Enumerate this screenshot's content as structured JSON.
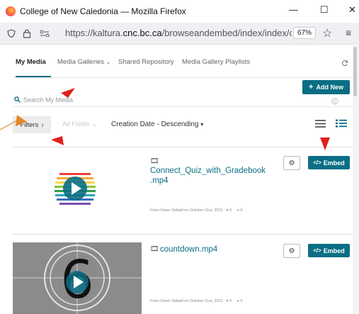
{
  "window": {
    "title": "College of New Caledonia — Mozilla Firefox",
    "minimize": "—",
    "maximize": "☐",
    "close": "✕"
  },
  "browser": {
    "url_prefix": "https://kaltura.",
    "url_domain": "cnc.bc.ca",
    "url_path": "/browseandembed/index/index/catnai",
    "zoom": "67%"
  },
  "nav": {
    "tabs": [
      {
        "label": "My Media",
        "active": true
      },
      {
        "label": "Media Galleries",
        "active": false
      },
      {
        "label": "Shared Repository",
        "active": false
      },
      {
        "label": "Media Gallery Playlists",
        "active": false
      }
    ]
  },
  "toolbar": {
    "add_new_label": "Add New",
    "search_placeholder": "Search My Media",
    "filters_label": "Filters",
    "all_fields_label": "All Fields",
    "sort_label": "Creation Date - Descending"
  },
  "media": [
    {
      "title": "Connect_Quiz_with_Gradebook.mp4",
      "title_line1": "Connect_Quiz_with_Gradebook",
      "title_line2": ".mp4",
      "meta": "From Owen Siddall on October 21st, 2021",
      "likes": "0",
      "comments": "0",
      "embed_label": "Embed"
    },
    {
      "title": "countdown.mp4",
      "meta": "From Owen Siddall on October 21st, 2021",
      "likes": "0",
      "comments": "0",
      "embed_label": "Embed"
    }
  ],
  "colors": {
    "accent": "#0a6e85",
    "annotation_red": "#e0201b",
    "annotation_orange": "#e08a2b"
  }
}
